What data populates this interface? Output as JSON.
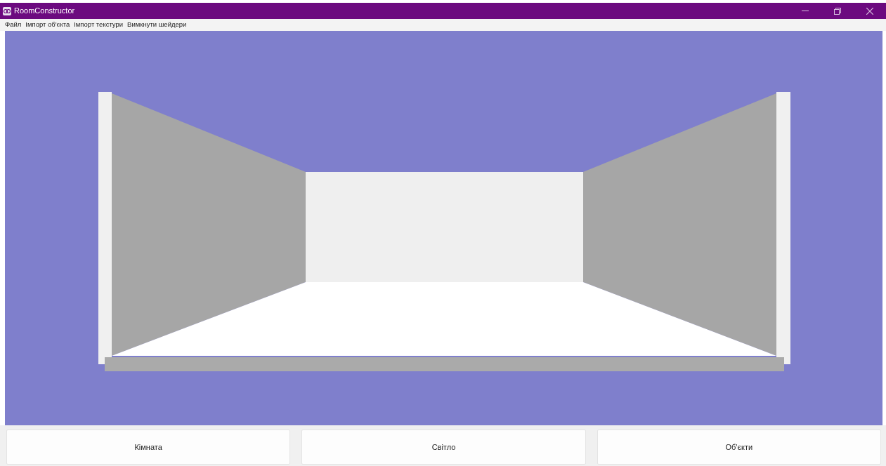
{
  "window": {
    "title": "RoomConstructor"
  },
  "menu": [
    "Файл",
    "Імпорт об'єкта",
    "Імпорт текстури",
    "Вимкнути шейдери"
  ],
  "buttons": [
    "Кімната",
    "Світло",
    "Об'єкти"
  ]
}
